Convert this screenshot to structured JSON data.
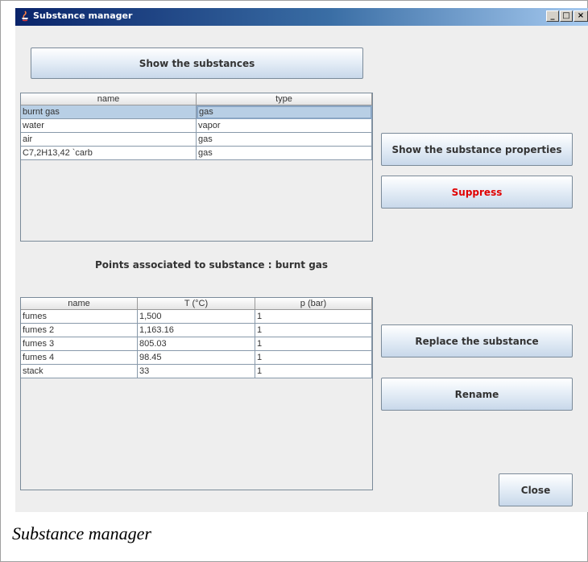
{
  "window": {
    "title": "Substance manager",
    "controls": [
      "_",
      "□",
      "×"
    ]
  },
  "buttons": {
    "show_substances": "Show the substances",
    "show_properties": "Show the substance properties",
    "suppress": "Suppress",
    "replace": "Replace the substance",
    "rename": "Rename",
    "close": "Close"
  },
  "substances_table": {
    "columns": [
      "name",
      "type"
    ],
    "rows": [
      {
        "name": "burnt gas",
        "type": "gas"
      },
      {
        "name": "water",
        "type": "vapor"
      },
      {
        "name": "air",
        "type": "gas"
      },
      {
        "name": "C7,2H13,42 `carb",
        "type": "gas"
      }
    ],
    "selected_index": 0
  },
  "points_label": "Points associated to substance : burnt gas",
  "points_table": {
    "columns": [
      "name",
      "T (°C)",
      "p (bar)"
    ],
    "rows": [
      {
        "name": "fumes",
        "t": "1,500",
        "p": "1"
      },
      {
        "name": "fumes 2",
        "t": "1,163.16",
        "p": "1"
      },
      {
        "name": "fumes 3",
        "t": "805.03",
        "p": "1"
      },
      {
        "name": "fumes 4",
        "t": "98.45",
        "p": "1"
      },
      {
        "name": "stack",
        "t": "33",
        "p": "1"
      }
    ]
  },
  "caption": "Substance manager",
  "colors": {
    "suppress_text": "#e00000",
    "selection": "#b8cfe5",
    "titlebar": "#0a246a"
  }
}
